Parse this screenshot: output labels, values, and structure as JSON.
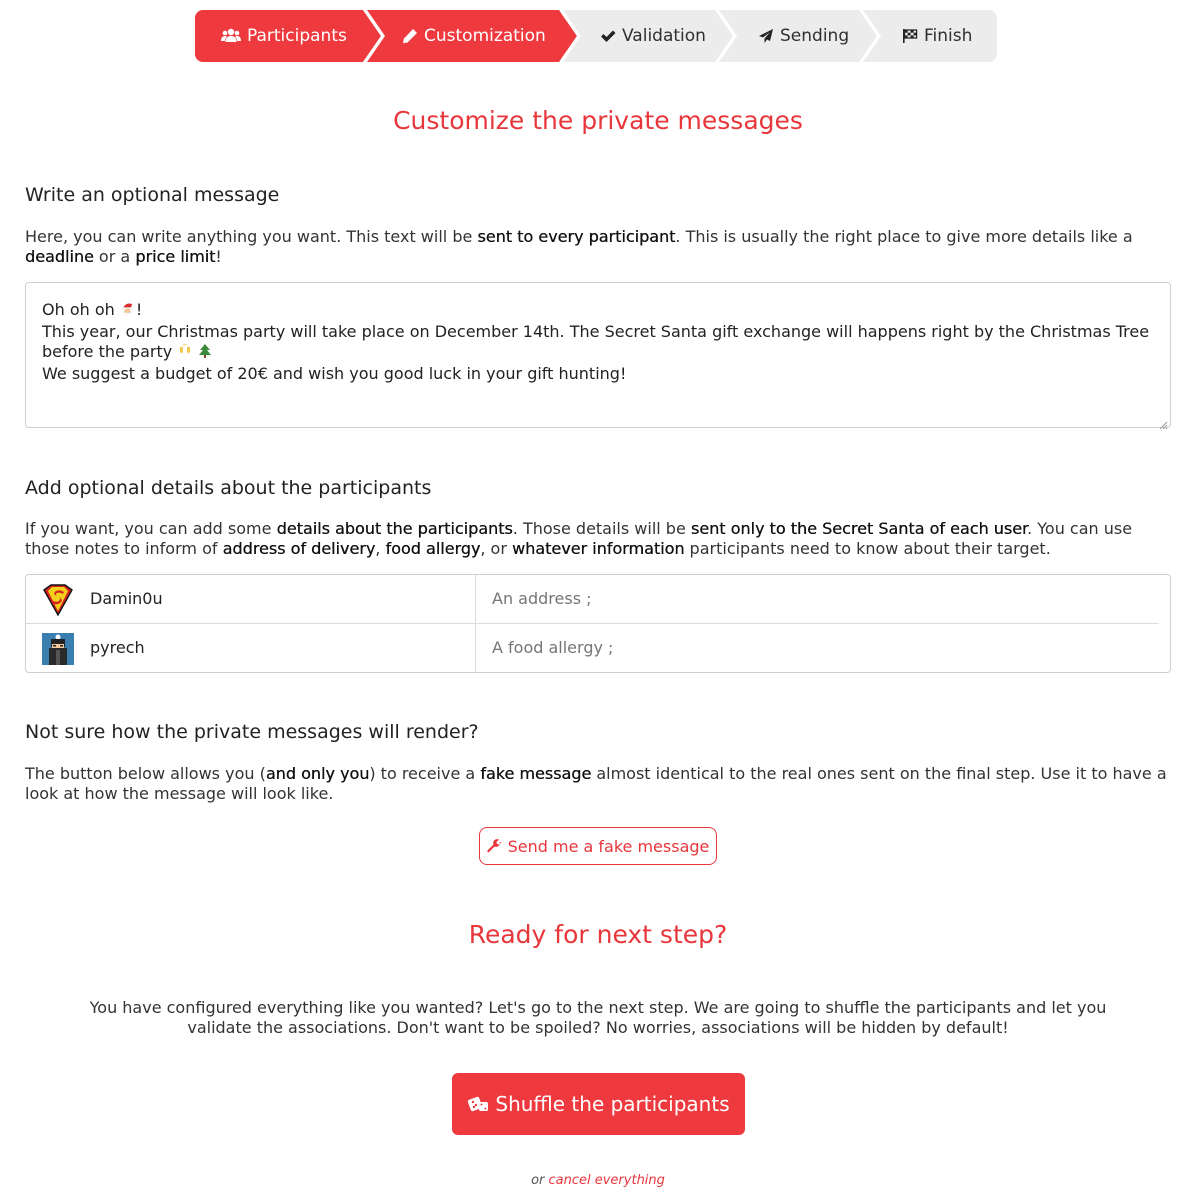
{
  "stepper": {
    "steps": [
      {
        "label": "Participants",
        "icon": "users-icon",
        "state": "done"
      },
      {
        "label": "Customization",
        "icon": "pencil-icon",
        "state": "active"
      },
      {
        "label": "Validation",
        "icon": "check-icon",
        "state": "pending"
      },
      {
        "label": "Sending",
        "icon": "paper-plane-icon",
        "state": "pending"
      },
      {
        "label": "Finish",
        "icon": "checkered-flag-icon",
        "state": "pending"
      }
    ]
  },
  "page_title": "Customize the private messages",
  "message_section": {
    "heading": "Write an optional message",
    "desc_1": "Here, you can write anything you want. This text will be ",
    "desc_b1": "sent to every participant",
    "desc_2": ". This is usually the right place to give more details like a ",
    "desc_b2": "deadline",
    "desc_3": " or a ",
    "desc_b3": "price limit",
    "desc_4": "!",
    "message_line1": "Oh oh oh ",
    "message_line1_end": "!",
    "message_line2": "This year, our Christmas party will take place on December 14th. The Secret Santa gift exchange will happens right by the Christmas Tree before the party ",
    "message_line3": "We suggest a budget of 20€ and wish you good luck in your gift hunting!"
  },
  "details_section": {
    "heading": "Add optional details about the participants",
    "desc_1": "If you want, you can add some ",
    "desc_b1": "details about the participants",
    "desc_2": ". Those details will be ",
    "desc_b2": "sent only to the Secret Santa of each user",
    "desc_3": ". You can use those notes to inform of ",
    "desc_b3": "address of delivery",
    "desc_4": ", ",
    "desc_b4": "food allergy",
    "desc_5": ", or ",
    "desc_b5": "whatever information",
    "desc_6": " participants need to know about their target.",
    "participants": [
      {
        "name": "Damin0u",
        "placeholder": "An address ;",
        "avatar": "superman-avatar"
      },
      {
        "name": "pyrech",
        "placeholder": "A food allergy ;",
        "avatar": "ninja-avatar"
      }
    ]
  },
  "preview_section": {
    "heading": "Not sure how the private messages will render?",
    "desc_1": "The button below allows you (",
    "desc_b1": "and only you",
    "desc_2": ") to receive a ",
    "desc_b2": "fake message",
    "desc_3": " almost identical to the real ones sent on the final step. Use it to have a look at how the message will look like.",
    "button_label": "Send me a fake message"
  },
  "next_section": {
    "heading": "Ready for next step?",
    "desc": "You have configured everything like you wanted? Let's go to the next step. We are going to shuffle the participants and let you validate the associations. Don't want to be spoiled? No worries, associations will be hidden by default!",
    "button_label": "Shuffle the participants",
    "or_text": "or ",
    "cancel_label": "cancel everything"
  },
  "colors": {
    "accent": "#e8363b",
    "stepper_bg": "#ececec"
  }
}
